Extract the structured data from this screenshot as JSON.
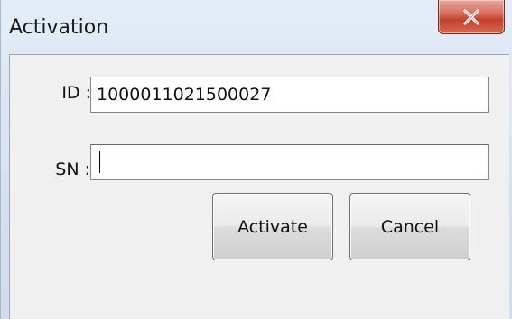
{
  "window": {
    "title": "Activation",
    "close_label": "X"
  },
  "form": {
    "id_label": "ID :",
    "id_value": "1000011021500027",
    "sn_label": "SN :",
    "sn_value": ""
  },
  "buttons": {
    "activate_label": "Activate",
    "cancel_label": "Cancel"
  },
  "colors": {
    "close_button": "#c2412d",
    "frame": "#d7e4f2",
    "client": "#f0f0f0"
  }
}
